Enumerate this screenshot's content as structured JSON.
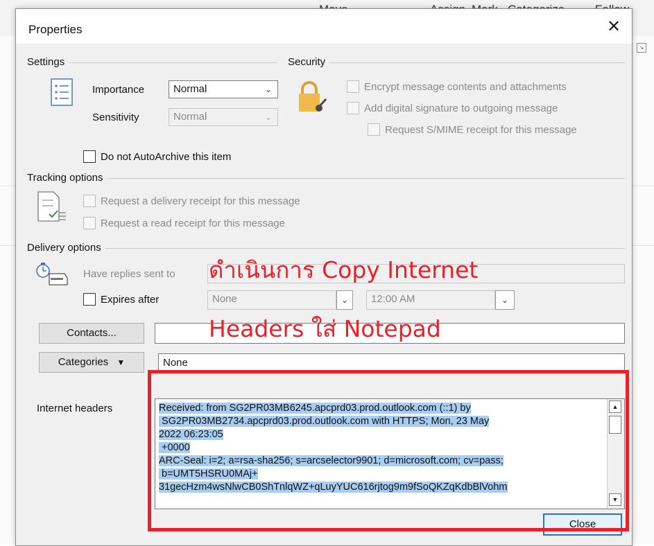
{
  "background_ribbon": {
    "items": [
      "Move",
      "Assign",
      "Mark",
      "Categorize",
      "Follow"
    ]
  },
  "dialog": {
    "title": "Properties",
    "close_icon": "close-icon"
  },
  "settings": {
    "section": "Settings",
    "importance_label": "Importance",
    "importance_value": "Normal",
    "sensitivity_label": "Sensitivity",
    "sensitivity_value": "Normal",
    "autoarchive_label": "Do not AutoArchive this item"
  },
  "security": {
    "section": "Security",
    "encrypt_label": "Encrypt message contents and attachments",
    "signature_label": "Add digital signature to outgoing message",
    "smime_label": "Request S/MIME receipt for this message"
  },
  "tracking": {
    "section": "Tracking options",
    "delivery_label": "Request a delivery receipt for this message",
    "read_label": "Request a read receipt for this message"
  },
  "delivery": {
    "section": "Delivery options",
    "replies_label": "Have replies sent to",
    "expires_label": "Expires after",
    "expires_date": "None",
    "expires_time": "12:00 AM"
  },
  "contacts": {
    "button_label": "Contacts...",
    "value": ""
  },
  "categories": {
    "button_label": "Categories",
    "value": "None"
  },
  "internet_headers": {
    "label": "Internet headers",
    "lines": [
      "Received: from SG2PR03MB6245.apcprd03.prod.outlook.com (::1) by",
      " SG2PR03MB2734.apcprd03.prod.outlook.com with HTTPS; Mon, 23 May",
      "2022 06:23:05",
      " +0000",
      "ARC-Seal: i=2; a=rsa-sha256; s=arcselector9901; d=microsoft.com; cv=pass;",
      " b=UMT5HSRU0MAj+",
      "31gecHzm4wsNlwCB0ShTnlqWZ+qLuyYUC616rjtog9m9fSoQKZqKdbBlVohm"
    ]
  },
  "close_button_label": "Close",
  "annotation": {
    "line1": "ดำเนินการ Copy Internet",
    "line2": "Headers ใส่ Notepad",
    "color": "#e8212b"
  }
}
